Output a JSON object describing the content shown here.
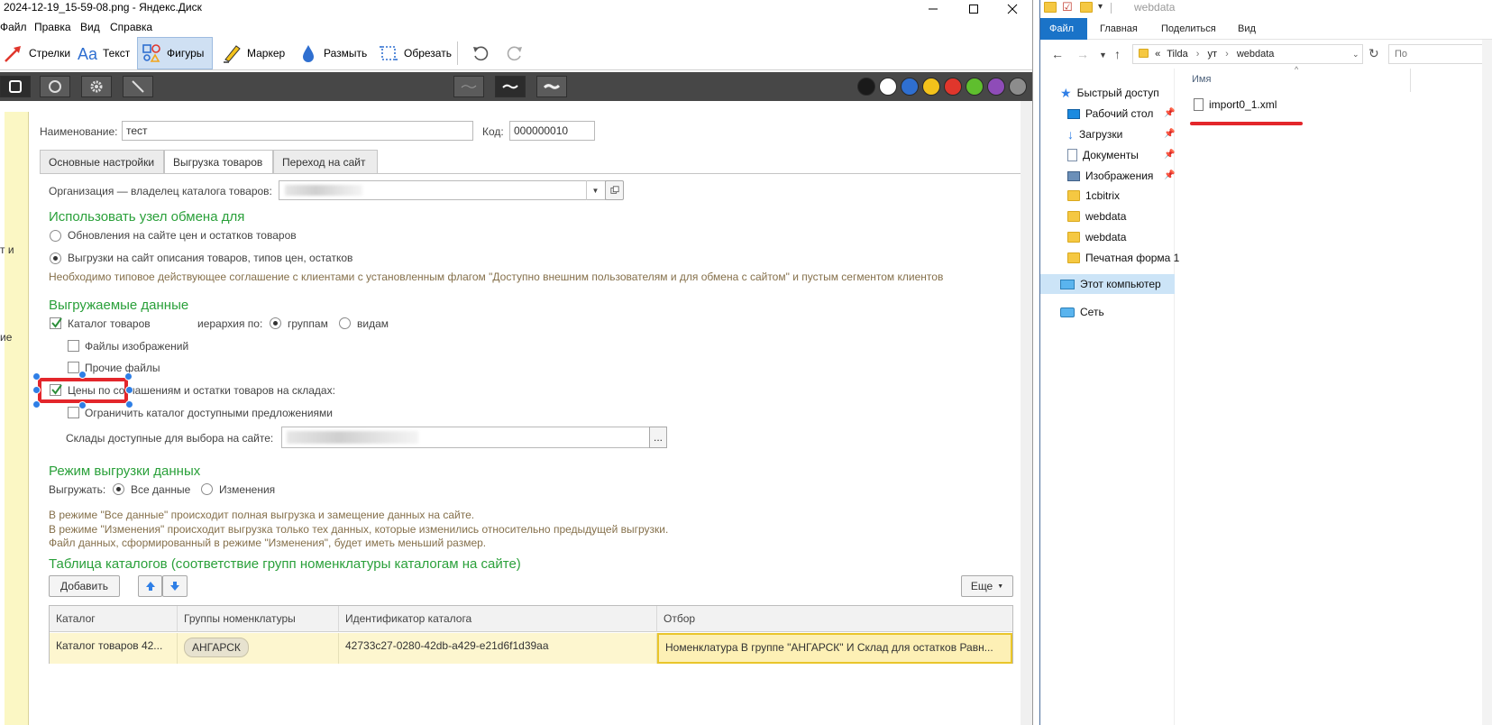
{
  "viewer": {
    "title": "2024-12-19_15-59-08.png - Яндекс.Диск",
    "menu": [
      "Файл",
      "Правка",
      "Вид",
      "Справка"
    ],
    "tools": {
      "arrows": "Стрелки",
      "text": "Текст",
      "shapes": "Фигуры",
      "marker": "Маркер",
      "blur": "Размыть",
      "crop": "Обрезать"
    },
    "colors": [
      "#1a1a1a",
      "#ffffff",
      "#2f6fd0",
      "#f3c21b",
      "#e0362c",
      "#5fbe2e",
      "#8e4cb8",
      "#8c8c8c"
    ],
    "cut_left_texts": [
      "т и",
      "ие"
    ]
  },
  "form": {
    "name_label": "Наименование:",
    "name_value": "тест",
    "code_label": "Код:",
    "code_value": "000000010",
    "tabs": [
      "Основные настройки",
      "Выгрузка товаров",
      "Переход на сайт"
    ],
    "org_label": "Организация — владелец каталога товаров:",
    "section_node": "Использовать узел обмена для",
    "radio_prices": "Обновления на сайте цен и остатков товаров",
    "radio_desc": "Выгрузки на сайт описания товаров, типов цен, остатков",
    "note_agreement": "Необходимо типовое действующее соглашение с клиентами с установленным флагом \"Доступно внешним пользователям и для обмена с сайтом\" и пустым сегментом клиентов",
    "section_data": "Выгружаемые данные",
    "chk_catalog": "Каталог товаров",
    "hierarchy_label": "иерархия по:",
    "radio_groups": "группам",
    "radio_kinds": "видам",
    "chk_images": "Файлы изображений",
    "chk_other": "Прочие файлы",
    "chk_prices": "Цены по соглашениям и остатки товаров на складах:",
    "chk_limit": "Ограничить каталог доступными предложениями",
    "warehouses_label": "Склады доступные для выбора на сайте:",
    "warehouses_btn": "...",
    "section_mode": "Режим выгрузки данных",
    "export_label": "Выгружать:",
    "radio_all": "Все данные",
    "radio_changes": "Изменения",
    "note_mode_1": "В режиме \"Все данные\" происходит полная выгрузка  и замещение данных на сайте.",
    "note_mode_2": "В режиме \"Изменения\" происходит выгрузка только тех данных, которые изменились относительно предыдущей выгрузки.",
    "note_mode_3": "Файл данных, сформированный в режиме \"Изменения\", будет иметь меньший размер.",
    "section_table": "Таблица каталогов (соответствие групп номенклатуры каталогам на сайте)",
    "btn_add": "Добавить",
    "btn_more": "Еще",
    "table": {
      "headers": [
        "Каталог",
        "Группы номенклатуры",
        "Идентификатор каталога",
        "Отбор"
      ],
      "row": [
        "Каталог товаров 42...",
        "АНГАРСК",
        "42733c27-0280-42db-a429-e21d6f1d39aa",
        "Номенклатура В группе \"АНГАРСК\" И Склад для остатков Равн..."
      ]
    }
  },
  "explorer": {
    "title": "webdata",
    "ribbon": [
      "Файл",
      "Главная",
      "Поделиться",
      "Вид"
    ],
    "address": [
      "«",
      "Tilda",
      "ут",
      "webdata"
    ],
    "column_name": "Имя",
    "search_cut": "По",
    "quick_access": "Быстрый доступ",
    "nav": [
      "Рабочий стол",
      "Загрузки",
      "Документы",
      "Изображения",
      "1cbitrix",
      "webdata",
      "webdata",
      "Печатная форма 1"
    ],
    "this_pc": "Этот компьютер",
    "network": "Сеть",
    "file": "import0_1.xml"
  }
}
